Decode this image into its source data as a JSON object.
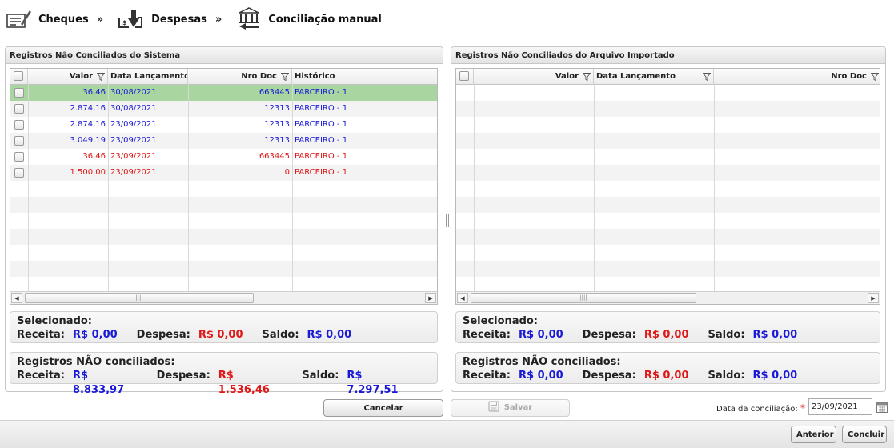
{
  "breadcrumb": {
    "items": [
      {
        "label": "Cheques",
        "icon": "cheque-edit-icon"
      },
      {
        "label": "Despesas",
        "icon": "expense-download-icon"
      },
      {
        "label": "Conciliação manual",
        "icon": "bank-reconcile-icon"
      }
    ],
    "separator": "»"
  },
  "left_panel": {
    "title": "Registros Não Conciliados do Sistema",
    "columns": [
      "Valor",
      "Data Lançamento",
      "Nro Doc",
      "Histórico"
    ],
    "rows": [
      {
        "valor": "36,46",
        "data": "30/08/2021",
        "nro": "663445",
        "hist": "PARCEIRO - 1",
        "color": "#1a1ad6",
        "selected": true
      },
      {
        "valor": "2.874,16",
        "data": "30/08/2021",
        "nro": "12313",
        "hist": "PARCEIRO - 1",
        "color": "#1a1ad6",
        "selected": false
      },
      {
        "valor": "2.874,16",
        "data": "23/09/2021",
        "nro": "12313",
        "hist": "PARCEIRO - 1",
        "color": "#1a1ad6",
        "selected": false
      },
      {
        "valor": "3.049,19",
        "data": "23/09/2021",
        "nro": "12313",
        "hist": "PARCEIRO - 1",
        "color": "#1a1ad6",
        "selected": false
      },
      {
        "valor": "36,46",
        "data": "23/09/2021",
        "nro": "663445",
        "hist": "PARCEIRO - 1",
        "color": "#e01818",
        "selected": false
      },
      {
        "valor": "1.500,00",
        "data": "23/09/2021",
        "nro": "0",
        "hist": "PARCEIRO - 1",
        "color": "#e01818",
        "selected": false
      }
    ],
    "selected": {
      "title": "Selecionado:",
      "receita_label": "Receita:",
      "receita": "R$ 0,00",
      "despesa_label": "Despesa:",
      "despesa": "R$ 0,00",
      "saldo_label": "Saldo:",
      "saldo": "R$ 0,00"
    },
    "not_reconciled": {
      "title": "Registros NÃO conciliados:",
      "receita_label": "Receita:",
      "receita": "R$ 8.833,97",
      "despesa_label": "Despesa:",
      "despesa": "R$ 1.536,46",
      "saldo_label": "Saldo:",
      "saldo": "R$ 7.297,51"
    }
  },
  "right_panel": {
    "title": "Registros Não Conciliados do Arquivo Importado",
    "columns": [
      "Valor",
      "Data Lançamento",
      "Nro Doc"
    ],
    "selected": {
      "title": "Selecionado:",
      "receita_label": "Receita:",
      "receita": "R$ 0,00",
      "despesa_label": "Despesa:",
      "despesa": "R$ 0,00",
      "saldo_label": "Saldo:",
      "saldo": "R$ 0,00"
    },
    "not_reconciled": {
      "title": "Registros NÃO conciliados:",
      "receita_label": "Receita:",
      "receita": "R$ 0,00",
      "despesa_label": "Despesa:",
      "despesa": "R$ 0,00",
      "saldo_label": "Saldo:",
      "saldo": "R$ 0,00"
    }
  },
  "actions": {
    "cancelar": "Cancelar",
    "salvar": "Salvar",
    "date_label": "Data da conciliação:",
    "date_value": "23/09/2021",
    "anterior": "Anterior",
    "concluir": "Concluir"
  },
  "colors": {
    "receita": "#1a1ad6",
    "despesa": "#e01818",
    "selected_row": "#a8d5a0"
  }
}
